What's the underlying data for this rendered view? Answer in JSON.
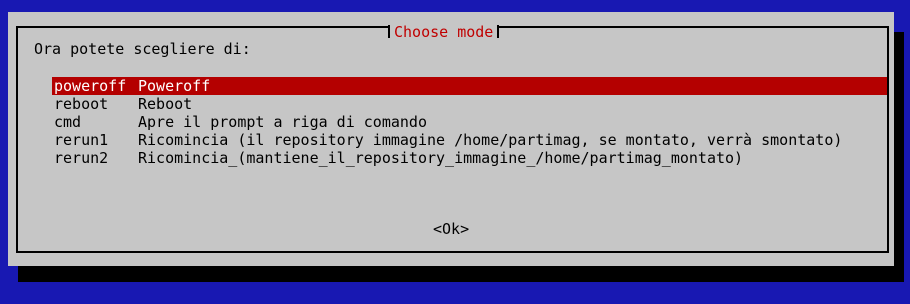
{
  "dialog": {
    "title": "Choose mode",
    "prompt": "Ora potete scegliere di:",
    "items": [
      {
        "tag": "poweroff",
        "description": "Poweroff",
        "selected": true
      },
      {
        "tag": "reboot",
        "description": "Reboot",
        "selected": false
      },
      {
        "tag": "cmd",
        "description": "Apre il prompt a riga di comando",
        "selected": false
      },
      {
        "tag": "rerun1",
        "description": "Ricomincia (il repository immagine /home/partimag, se montato, verrà smontato)",
        "selected": false
      },
      {
        "tag": "rerun2",
        "description": "Ricomincia_(mantiene_il_repository_immagine_/home/partimag_montato)",
        "selected": false
      }
    ],
    "ok_label": "<Ok>"
  },
  "colors": {
    "background": "#1818b2",
    "dialog": "#c6c6c6",
    "title": "#c00000",
    "selection": "#b40000"
  }
}
